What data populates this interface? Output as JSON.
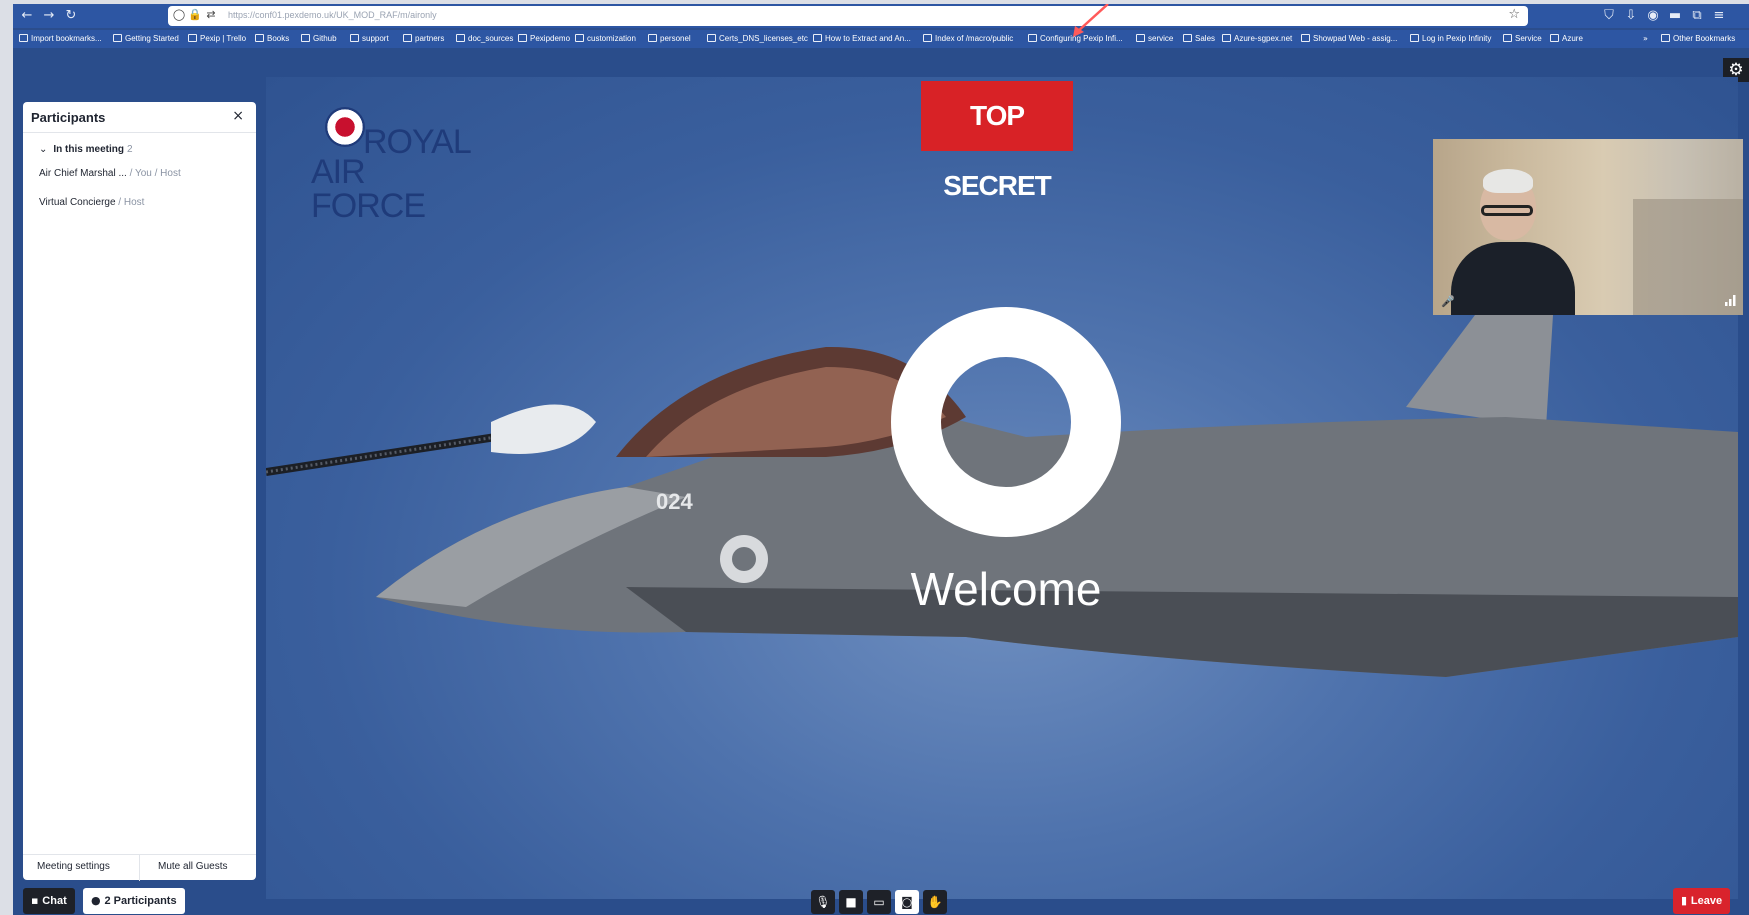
{
  "browser": {
    "url": "https://conf01.pexdemo.uk/UK_MOD_RAF/m/aironly",
    "icons": {
      "back": "arrow-left-icon",
      "forward": "arrow-right-icon",
      "reload": "reload-icon",
      "star": "star-icon"
    },
    "bookmarks": [
      "Import bookmarks...",
      "Getting Started",
      "Pexip | Trello",
      "Books",
      "Github",
      "support",
      "partners",
      "doc_sources",
      "Pexipdemo",
      "customization",
      "personel",
      "Certs_DNS_licenses_etc",
      "How to Extract and An...",
      "Index of /macro/public",
      "Configuring Pexip Infi...",
      "service",
      "Sales",
      "Azure-sgpex.net",
      "Showpad Web - assig...",
      "Log in Pexip Infinity",
      "Service",
      "Azure"
    ],
    "other_bookmarks": "Other Bookmarks"
  },
  "stage": {
    "classification_banner": "TOP SECRET",
    "logo_text_line1": "ROYAL",
    "logo_text_line2": "AIR FORCE",
    "welcome": "Welcome",
    "jet_number": "024"
  },
  "participants_panel": {
    "title": "Participants",
    "section_label": "In this meeting",
    "section_count": "2",
    "participants": [
      {
        "name": "Air Chief Marshal ...",
        "role": " / You / Host"
      },
      {
        "name": "Virtual Concierge",
        "role": " / Host"
      }
    ],
    "meeting_settings": "Meeting settings",
    "mute_all": "Mute all Guests"
  },
  "controls": {
    "chat": "Chat",
    "participants": "2 Participants",
    "leave": "Leave"
  },
  "colors": {
    "leave": "#d9232c",
    "banner": "#d82226",
    "browser_chrome": "#2d56a3"
  }
}
